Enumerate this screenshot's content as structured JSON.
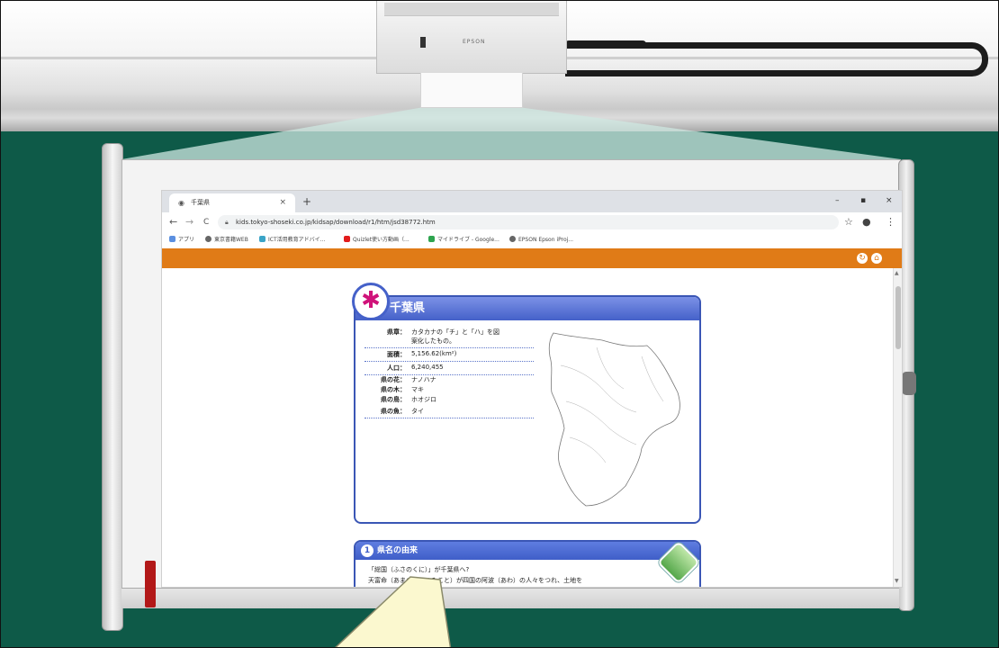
{
  "projector": {
    "label": "EPSON"
  },
  "browser": {
    "tab_title": "千葉県",
    "tab_close": "×",
    "new_tab": "+",
    "win_min": "–",
    "win_max": "▪",
    "win_close": "×",
    "back": "←",
    "forward": "→",
    "reload": "C",
    "url": "kids.tokyo-shoseki.co.jp/kidsap/download/r1/htm/jsd38772.htm",
    "star": "☆",
    "account": "●",
    "menu": "⋮",
    "bookmarks": [
      "アプリ",
      "東京書籍WEB",
      "ICT活用教育アドバイ...",
      "Quizlet使い方動画（...",
      "マイドライブ - Google...",
      "EPSON Epson iProj..."
    ]
  },
  "card": {
    "title": "千葉県",
    "emblem": "✱",
    "rows": [
      {
        "label": "県章：",
        "value": "カタカナの「チ」と「ハ」を図",
        "value2": "案化したもの。"
      },
      {
        "label": "面積：",
        "value": "5,156.62(km²)"
      },
      {
        "label": "人口：",
        "value": "6,240,455"
      },
      {
        "label": "県の花：",
        "value": "ナノハナ"
      },
      {
        "label": "県の木：",
        "value": "マキ"
      },
      {
        "label": "県の鳥：",
        "value": "ホオジロ"
      },
      {
        "label": "県の魚：",
        "value": "タイ"
      }
    ]
  },
  "section": {
    "number": "1",
    "title": "県名の由来",
    "line1": "「総国（ふさのくに）」が千葉県へ?",
    "line2": "天富命（あまのとみのみこと）が四国の阿波（あわ）の人々をつれ、土地を"
  }
}
